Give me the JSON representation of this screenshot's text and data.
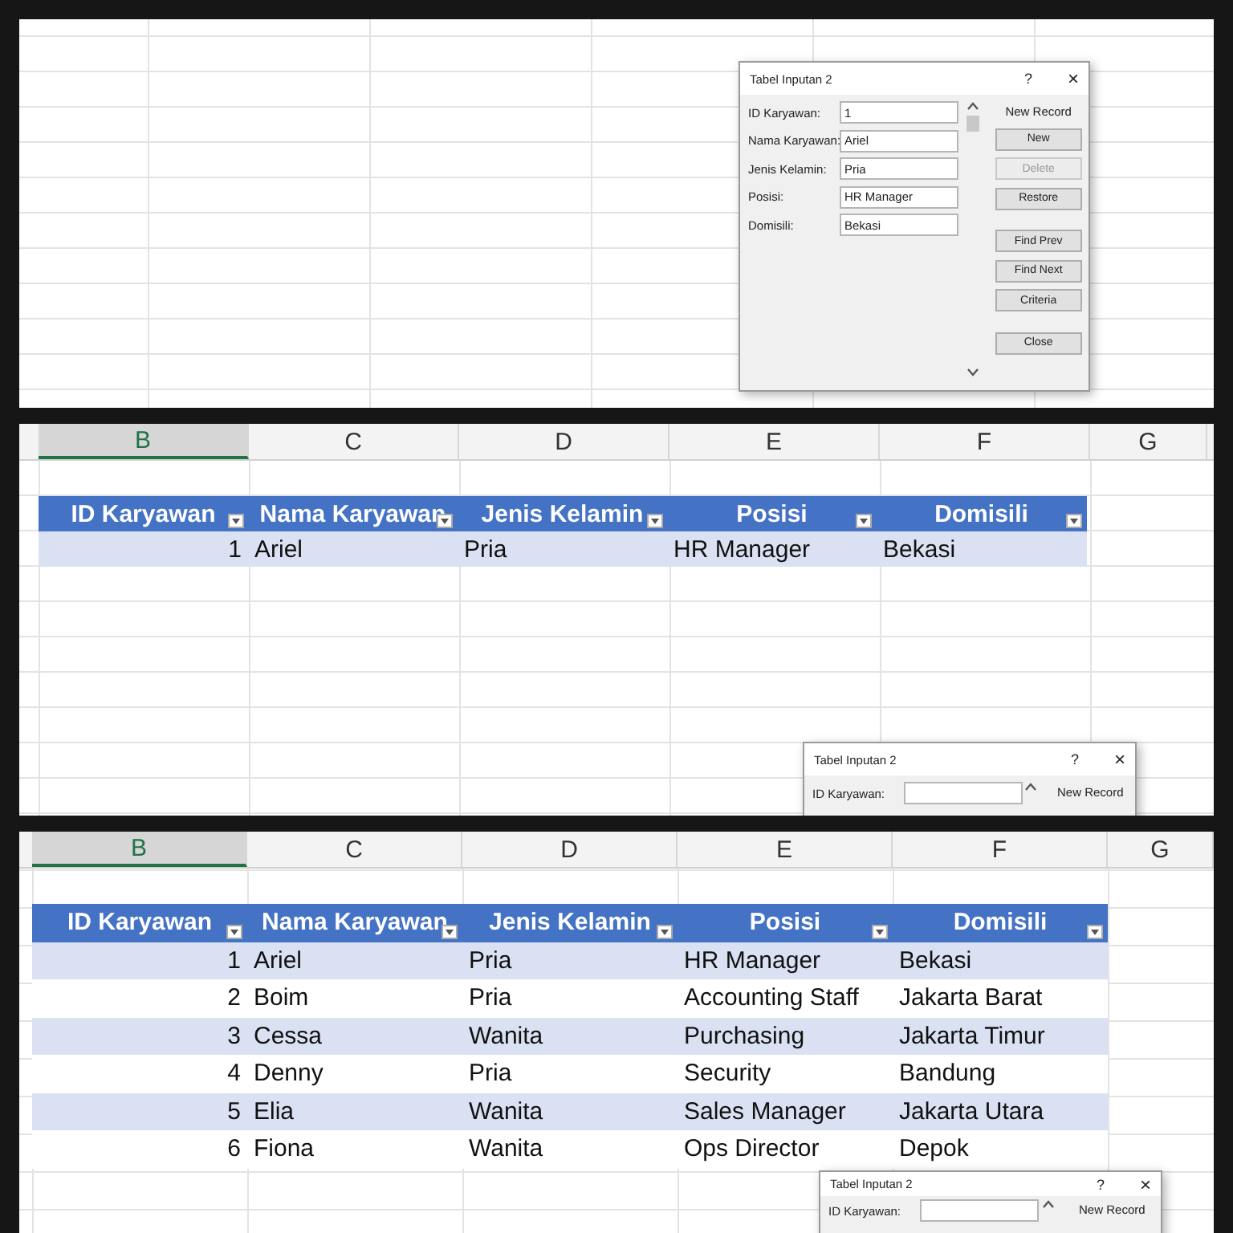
{
  "panels": [
    {
      "kind": "sheet",
      "dialog": {
        "title": "Tabel Inputan 2",
        "help": "?",
        "close": "×",
        "record_label": "New Record",
        "fields": [
          {
            "label": "ID Karyawan:",
            "value": "1"
          },
          {
            "label": "Nama Karyawan:",
            "value": "Ariel"
          },
          {
            "label": "Jenis Kelamin:",
            "value": "Pria"
          },
          {
            "label": "Posisi:",
            "value": "HR Manager"
          },
          {
            "label": "Domisili:",
            "value": "Bekasi"
          }
        ],
        "buttons": [
          {
            "label": "New",
            "disabled": false
          },
          {
            "label": "Delete",
            "disabled": true
          },
          {
            "label": "Restore",
            "disabled": false
          },
          {
            "label": "Find Prev",
            "disabled": false
          },
          {
            "label": "Find Next",
            "disabled": false
          },
          {
            "label": "Criteria",
            "disabled": false
          },
          {
            "label": "Close",
            "disabled": false
          }
        ]
      }
    },
    {
      "kind": "sheet",
      "column_headers": [
        {
          "label": "B",
          "selected": true
        },
        {
          "label": "C",
          "selected": false
        },
        {
          "label": "D",
          "selected": false
        },
        {
          "label": "E",
          "selected": false
        },
        {
          "label": "F",
          "selected": false
        },
        {
          "label": "G",
          "selected": false
        }
      ],
      "table": {
        "columns": [
          "ID Karyawan",
          "Nama Karyawan",
          "Jenis Kelamin",
          "Posisi",
          "Domisili"
        ],
        "rows": [
          [
            "1",
            "Ariel",
            "Pria",
            "HR Manager",
            "Bekasi"
          ]
        ]
      },
      "dialog": {
        "title": "Tabel Inputan 2",
        "help": "?",
        "close": "×",
        "record_label": "New Record",
        "fields": [
          {
            "label": "ID Karyawan:"
          }
        ]
      }
    },
    {
      "kind": "sheet",
      "column_headers": [
        {
          "label": "B",
          "selected": true
        },
        {
          "label": "C",
          "selected": false
        },
        {
          "label": "D",
          "selected": false
        },
        {
          "label": "E",
          "selected": false
        },
        {
          "label": "F",
          "selected": false
        },
        {
          "label": "G",
          "selected": false
        }
      ],
      "table": {
        "columns": [
          "ID Karyawan",
          "Nama Karyawan",
          "Jenis Kelamin",
          "Posisi",
          "Domisili"
        ],
        "rows": [
          [
            "1",
            "Ariel",
            "Pria",
            "HR Manager",
            "Bekasi"
          ],
          [
            "2",
            "Boim",
            "Pria",
            "Accounting Staff",
            "Jakarta Barat"
          ],
          [
            "3",
            "Cessa",
            "Wanita",
            "Purchasing",
            "Jakarta Timur"
          ],
          [
            "4",
            "Denny",
            "Pria",
            "Security",
            "Bandung"
          ],
          [
            "5",
            "Elia",
            "Wanita",
            "Sales Manager",
            "Jakarta Utara"
          ],
          [
            "6",
            "Fiona",
            "Wanita",
            "Ops Director",
            "Depok"
          ]
        ]
      },
      "dialog": {
        "title": "Tabel Inputan 2",
        "help": "?",
        "close": "×",
        "record_label": "New Record",
        "fields": [
          {
            "label": "ID Karyawan:"
          }
        ]
      }
    }
  ]
}
